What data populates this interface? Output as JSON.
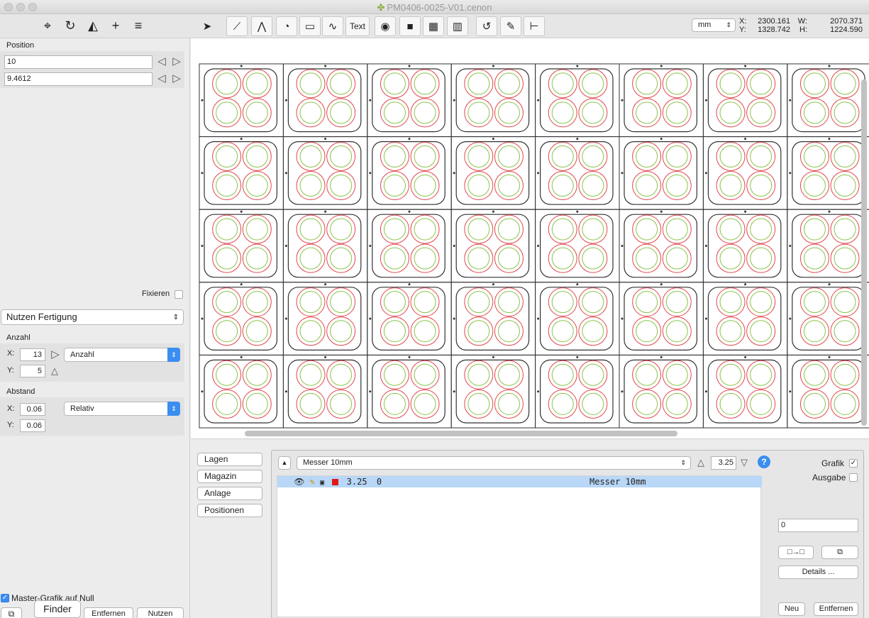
{
  "window": {
    "title": "PM0406-0025-V01.cenon"
  },
  "toolbar": {
    "left_tools": [
      {
        "name": "crosshair-tool-icon",
        "glyph": "⌖"
      },
      {
        "name": "rotate-tool-icon",
        "glyph": "↻"
      },
      {
        "name": "paint-tool-icon",
        "glyph": "◭"
      },
      {
        "name": "add-tool-icon",
        "glyph": "+"
      },
      {
        "name": "layers-tool-icon",
        "glyph": "≡"
      }
    ],
    "drawing_tools": [
      {
        "name": "arrow-tool-icon",
        "glyph": "➤"
      },
      {
        "name": "line-tool-icon",
        "glyph": "⟋"
      },
      {
        "name": "polyline-tool-icon",
        "glyph": "⋀"
      },
      {
        "name": "arc-tool-icon",
        "glyph": "◔"
      },
      {
        "name": "rectangle-tool-icon",
        "glyph": "▭"
      },
      {
        "name": "curve-tool-icon",
        "glyph": "∿"
      },
      {
        "name": "text-tool-icon",
        "glyph": "Text"
      },
      {
        "name": "mark-tool-icon",
        "glyph": "◉"
      },
      {
        "name": "fill-tool-icon",
        "glyph": "■"
      },
      {
        "name": "hatch-tool-icon",
        "glyph": "▦"
      },
      {
        "name": "grid-tool-icon",
        "glyph": "▥"
      },
      {
        "name": "rotate-object-icon",
        "glyph": "↺"
      },
      {
        "name": "knife-tool-icon",
        "glyph": "✎"
      },
      {
        "name": "measure-tool-icon",
        "glyph": "⊢"
      }
    ],
    "unit": "mm",
    "coords": {
      "x_label": "X:",
      "x": "2300.161",
      "y_label": "Y:",
      "y": "1328.742",
      "w_label": "W:",
      "w": "2070.371",
      "h_label": "H:",
      "h": "1224.590"
    }
  },
  "left": {
    "position_label": "Position",
    "pos_x": "10",
    "pos_y": "9.4612",
    "fixieren_label": "Fixieren",
    "mode_select": "Nutzen Fertigung",
    "anzahl_label": "Anzahl",
    "anzahl_x_label": "X:",
    "anzahl_x": "13",
    "anzahl_y_label": "Y:",
    "anzahl_y": "5",
    "anzahl_mode": "Anzahl",
    "abstand_label": "Abstand",
    "abstand_x_label": "X:",
    "abstand_x": "0.06",
    "abstand_y_label": "Y:",
    "abstand_y": "0.06",
    "abstand_mode": "Relativ",
    "master_label": "Master-Grafik auf Null",
    "finder_label": "Finder",
    "entfernen_label": "Entfernen",
    "nutzen_label": "Nutzen"
  },
  "canvas": {
    "cols": 8,
    "rows": 5,
    "stroke_color": "#333333",
    "red": "#e0474f",
    "green": "#8bc34a"
  },
  "bottom": {
    "tabs": [
      "Lagen",
      "Magazin",
      "Anlage",
      "Positionen"
    ],
    "tool_select": "Messer 10mm",
    "depth": "3.25",
    "help": "?",
    "grafik_label": "Grafik",
    "grafik_check": "✓",
    "ausgabe_label": "Ausgabe",
    "layer_row": {
      "value": "3.25",
      "index": "0",
      "name": "Messer 10mm"
    },
    "value_field": "0",
    "copy_label": "□→□",
    "details_label": "Details ...",
    "neu_label": "Neu",
    "entfernen_label": "Entfernen"
  }
}
